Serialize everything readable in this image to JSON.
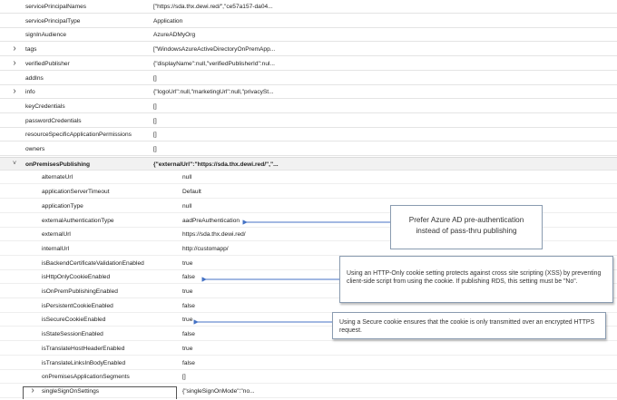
{
  "properties": [
    {
      "key": "servicePrincipalNames",
      "value": "[\"https://sda.thx.dewi.red/\",\"ce57a157-da04...",
      "chevron": false,
      "level": 0
    },
    {
      "key": "servicePrincipalType",
      "value": "Application",
      "chevron": false,
      "level": 0
    },
    {
      "key": "signInAudience",
      "value": "AzureADMyOrg",
      "chevron": false,
      "level": 0
    },
    {
      "key": "tags",
      "value": "[\"WindowsAzureActiveDirectoryOnPremApp...",
      "chevron": true,
      "level": 0
    },
    {
      "key": "verifiedPublisher",
      "value": "{\"displayName\":null,\"verifiedPublisherId\":nul...",
      "chevron": true,
      "level": 0
    },
    {
      "key": "addIns",
      "value": "[]",
      "chevron": false,
      "level": 0
    },
    {
      "key": "info",
      "value": "{\"logoUrl\":null,\"marketingUrl\":null,\"privacySt...",
      "chevron": true,
      "level": 0
    },
    {
      "key": "keyCredentials",
      "value": "[]",
      "chevron": false,
      "level": 0
    },
    {
      "key": "passwordCredentials",
      "value": "[]",
      "chevron": false,
      "level": 0
    },
    {
      "key": "resourceSpecificApplicationPermissions",
      "value": "[]",
      "chevron": false,
      "level": 0
    },
    {
      "key": "owners",
      "value": "[]",
      "chevron": false,
      "level": 0
    },
    {
      "key": "onPremisesPublishing",
      "value": "{\"externalUrl\":\"https://sda.thx.dewi.red/\",\"...",
      "chevron": true,
      "expanded": true,
      "level": 0
    },
    {
      "key": "alternateUrl",
      "value": "null",
      "level": 1
    },
    {
      "key": "applicationServerTimeout",
      "value": "Default",
      "level": 1
    },
    {
      "key": "applicationType",
      "value": "null",
      "level": 1
    },
    {
      "key": "externalAuthenticationType",
      "value": "aadPreAuthentication",
      "level": 1
    },
    {
      "key": "externalUrl",
      "value": "https://sda.thx.dewi.red/",
      "level": 1
    },
    {
      "key": "internalUrl",
      "value": "http://customapp/",
      "level": 1
    },
    {
      "key": "isBackendCertificateValidationEnabled",
      "value": "true",
      "level": 1
    },
    {
      "key": "isHttpOnlyCookieEnabled",
      "value": "false",
      "level": 1
    },
    {
      "key": "isOnPremPublishingEnabled",
      "value": "true",
      "level": 1
    },
    {
      "key": "isPersistentCookieEnabled",
      "value": "false",
      "level": 1
    },
    {
      "key": "isSecureCookieEnabled",
      "value": "true",
      "level": 1
    },
    {
      "key": "isStateSessionEnabled",
      "value": "false",
      "level": 1
    },
    {
      "key": "isTranslateHostHeaderEnabled",
      "value": "true",
      "level": 1
    },
    {
      "key": "isTranslateLinksInBodyEnabled",
      "value": "false",
      "level": 1
    },
    {
      "key": "onPremisesApplicationSegments",
      "value": "[]",
      "level": 1
    },
    {
      "key": "singleSignOnSettings",
      "value": "{\"singleSignOnMode\":\"no...",
      "chevron": true,
      "level": 1
    }
  ],
  "callouts": {
    "azure_ad": "Prefer Azure AD pre-authentication instead of pass-thru publishing",
    "httponly": "Using an HTTP-Only cookie setting protects against cross site scripting (XSS) by preventing client-side script from using the cookie. If publishing RDS, this setting must be \"No\".",
    "secure": "Using a Secure cookie ensures that the cookie is only transmitted over an encrypted HTTPS request."
  },
  "colors": {
    "arrow": "#4472c4",
    "callout_border": "#8a9bb0",
    "expanded_row_bg": "#f1f1f1"
  },
  "icons": {
    "collapsed": "chevron-right-icon",
    "expanded": "chevron-down-icon"
  }
}
